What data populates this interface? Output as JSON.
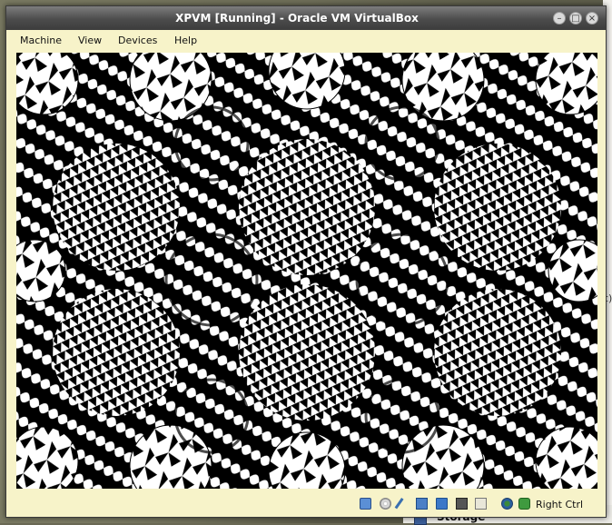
{
  "window": {
    "title": "XPVM [Running] - Oracle VM VirtualBox"
  },
  "menubar": {
    "items": [
      "Machine",
      "View",
      "Devices",
      "Help"
    ]
  },
  "statusbar": {
    "icons": [
      "hard-disk-icon",
      "optical-drive-icon",
      "usb-icon",
      "network-icon",
      "shared-folders-icon",
      "display-icon",
      "video-capture-icon",
      "mouse-integration-icon",
      "host-key-arrow-icon"
    ],
    "host_key": "Right Ctrl"
  },
  "background": {
    "panel_label": "Storage",
    "edge_fragment": "c)"
  },
  "colors": {
    "window_bg": "#f7f3c9",
    "titlebar": "#4c4c4c",
    "vm_fg": "#ffffff",
    "vm_bg": "#000000"
  }
}
